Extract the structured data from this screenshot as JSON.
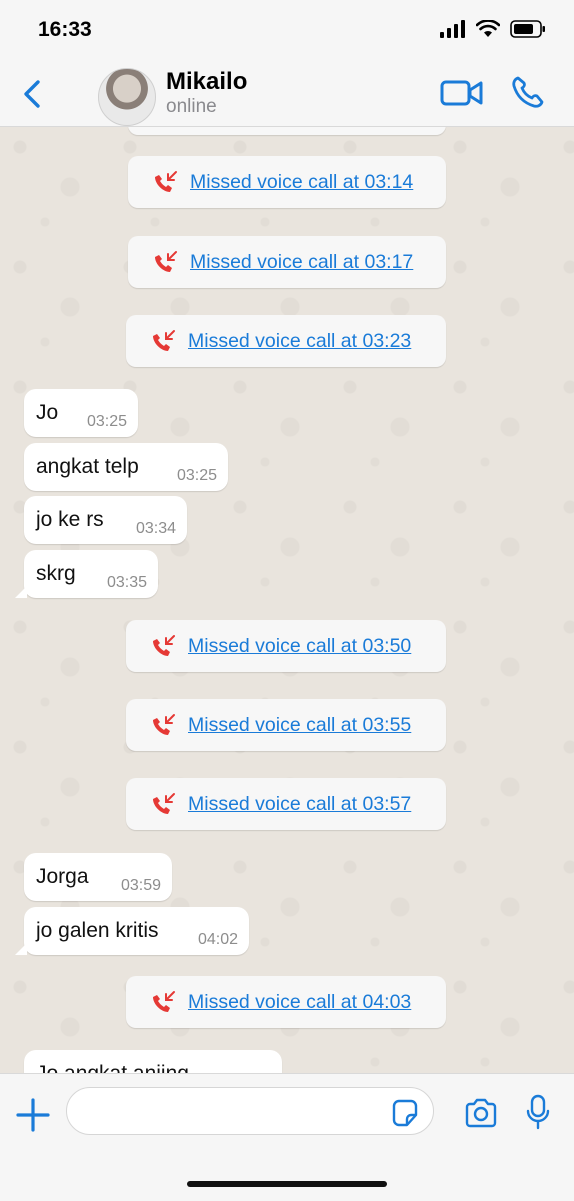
{
  "status_bar": {
    "time": "16:33"
  },
  "header": {
    "contact_name": "Mikailo",
    "contact_status": "online"
  },
  "messages": [
    {
      "type": "call",
      "text": "Missed voice call at 03:14"
    },
    {
      "type": "call",
      "text": "Missed voice call at 03:17"
    },
    {
      "type": "call",
      "text": "Missed voice call at 03:23"
    },
    {
      "type": "msg",
      "text": "Jo",
      "time": "03:25"
    },
    {
      "type": "msg",
      "text": "angkat telp",
      "time": "03:25"
    },
    {
      "type": "msg",
      "text": "jo ke rs",
      "time": "03:34"
    },
    {
      "type": "msg",
      "text": "skrg",
      "time": "03:35"
    },
    {
      "type": "call",
      "text": "Missed voice call at 03:50"
    },
    {
      "type": "call",
      "text": "Missed voice call at 03:55"
    },
    {
      "type": "call",
      "text": "Missed voice call at 03:57"
    },
    {
      "type": "msg",
      "text": "Jorga",
      "time": "03:59"
    },
    {
      "type": "msg",
      "text": "jo galen kritis",
      "time": "04:02"
    },
    {
      "type": "call",
      "text": "Missed voice call at 04:03"
    },
    {
      "type": "msg",
      "text": "Jo angkat anjing",
      "time": ""
    }
  ],
  "input": {
    "placeholder": ""
  },
  "icons": {
    "back": "chevron-left-icon",
    "video": "video-camera-icon",
    "phone": "phone-icon",
    "missed_call": "missed-call-icon",
    "plus": "plus-icon",
    "sticker": "sticker-icon",
    "camera": "camera-icon",
    "mic": "microphone-icon"
  },
  "colors": {
    "accent": "#1a7bd8",
    "missed": "#e53935",
    "chat_bg": "#e9e4dd"
  }
}
